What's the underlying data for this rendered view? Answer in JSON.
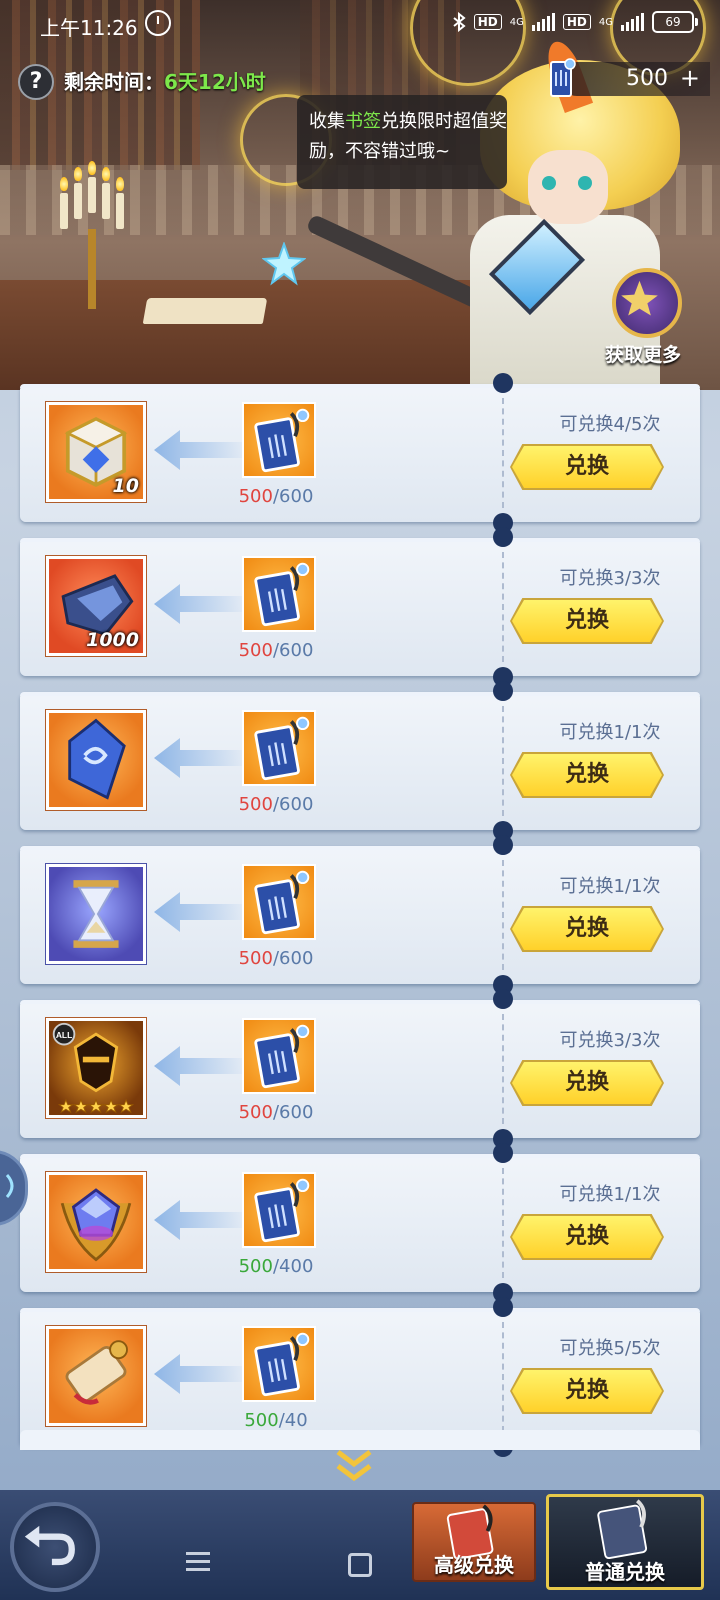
{
  "statusbar": {
    "time": "上午11:26",
    "hd1": "HD",
    "net1": "4G",
    "hd2": "HD",
    "net2": "4G",
    "battery": "69"
  },
  "header": {
    "help_label": "?",
    "remaining_label": "剩余时间：",
    "remaining_value": "6天12小时",
    "currency_count": "500",
    "currency_plus": "+",
    "tooltip_prefix": "收集",
    "tooltip_highlight": "书签",
    "tooltip_rest": "兑换限时超值奖励，不容错过哦~",
    "get_more": "获取更多"
  },
  "rows": [
    {
      "qty": "10",
      "have": "500",
      "need": "/600",
      "have_color": "red",
      "limit": "可兑换4/5次",
      "button": "兑换"
    },
    {
      "qty": "1000",
      "have": "500",
      "need": "/600",
      "have_color": "red",
      "limit": "可兑换3/3次",
      "button": "兑换"
    },
    {
      "qty": "",
      "have": "500",
      "need": "/600",
      "have_color": "red",
      "limit": "可兑换1/1次",
      "button": "兑换"
    },
    {
      "qty": "",
      "have": "500",
      "need": "/600",
      "have_color": "red",
      "limit": "可兑换1/1次",
      "button": "兑换"
    },
    {
      "qty": "",
      "have": "500",
      "need": "/600",
      "have_color": "red",
      "limit": "可兑换3/3次",
      "button": "兑换"
    },
    {
      "qty": "",
      "have": "500",
      "need": "/400",
      "have_color": "green",
      "limit": "可兑换1/1次",
      "button": "兑换"
    },
    {
      "qty": "",
      "have": "500",
      "need": "/40",
      "have_color": "green",
      "limit": "可兑换5/5次",
      "button": "兑换"
    }
  ],
  "bottom": {
    "tab_advanced": "高级兑换",
    "tab_normal": "普通兑换"
  },
  "colors": {
    "accent_yellow": "#ffd12a",
    "green_text": "#7de84b",
    "red_text": "#e0453f"
  }
}
